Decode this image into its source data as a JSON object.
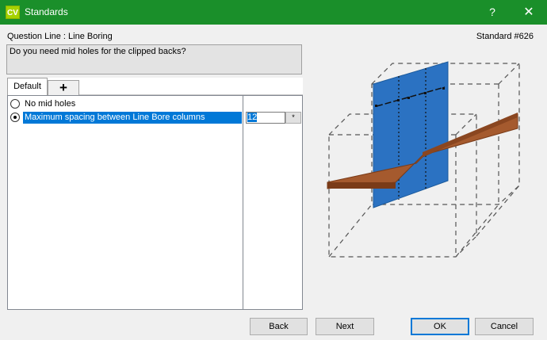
{
  "window": {
    "icon_text": "CV",
    "title": "Standards",
    "help_label": "?",
    "close_label": "✕",
    "accent": "#1a8f2a"
  },
  "question": {
    "label": "Question Line : Line Boring",
    "standard": "Standard #626",
    "text": "Do you need mid holes for the clipped backs?"
  },
  "tabs": [
    {
      "label": "Default",
      "selected": true
    },
    {
      "label": "+",
      "icon": "plus-icon"
    }
  ],
  "options": [
    {
      "label": "No mid holes",
      "checked": false
    },
    {
      "label": "Maximum spacing between Line Bore columns",
      "checked": true,
      "value": "12"
    }
  ],
  "dropdown_glyph": "*",
  "diagram_colors": {
    "panel": "#2b72c2",
    "shelf_top": "#a55a2e",
    "shelf_edge": "#7a3b18"
  },
  "buttons": {
    "back": "Back",
    "next": "Next",
    "ok": "OK",
    "cancel": "Cancel"
  }
}
